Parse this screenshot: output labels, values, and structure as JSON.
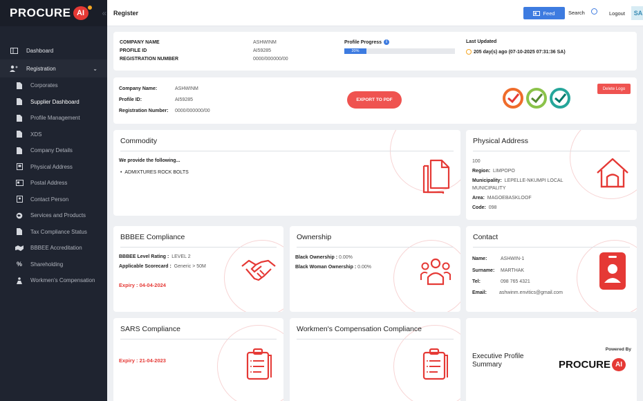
{
  "brand": {
    "name": "PROCURE",
    "ai": "AI"
  },
  "sidebar": {
    "items": [
      {
        "label": "Dashboard",
        "icon": "dashboard-icon"
      },
      {
        "label": "Registration",
        "icon": "user-plus-icon"
      }
    ],
    "sub_items": [
      {
        "label": "Corporates"
      },
      {
        "label": "Supplier Dashboard"
      },
      {
        "label": "Profile Management"
      },
      {
        "label": "XDS"
      },
      {
        "label": "Company Details"
      },
      {
        "label": "Physical Address"
      },
      {
        "label": "Postal Address"
      },
      {
        "label": "Contact Person"
      },
      {
        "label": "Services and Products"
      },
      {
        "label": "Tax Compliance Status"
      },
      {
        "label": "BBBEE Accreditation"
      },
      {
        "label": "Shareholding"
      },
      {
        "label": "Workmen's Compensation"
      }
    ]
  },
  "header": {
    "title": "Register",
    "feed": "Feed",
    "search": "Search",
    "logout": "Logout",
    "avatar": "SA"
  },
  "summary": {
    "company_name_label": "COMPANY NAME",
    "company_name": "ASHWINM",
    "profile_id_label": "PROFILE ID",
    "profile_id": "AI59285",
    "reg_label": "REGISTRATION NUMBER",
    "reg": "0000/000000/00",
    "progress_label": "Profile Progress",
    "progress_text": "20%",
    "progress_value": 0.2,
    "updated_label": "Last Updated",
    "updated": "205 day(s) ago (07-10-2025 07:31:36 SA)"
  },
  "company": {
    "name_label": "Company Name:",
    "name": "ASHWINM",
    "id_label": "Profile ID:",
    "id": "AI59285",
    "reg_label": "Registration Number:",
    "reg": "0000/000000/00",
    "export": "EXPORT TO PDF",
    "delete_logo": "Delete Logo"
  },
  "commodity": {
    "title": "Commodity",
    "intro": "We provide the following...",
    "items": [
      "ADMIXTURES ROCK BOLTS"
    ]
  },
  "physical": {
    "title": "Physical Address",
    "line1": "100",
    "region_label": "Region:",
    "region": "LIMPOPO",
    "municipality_label": "Municipality:",
    "municipality": "LEPELLE-NKUMPI LOCAL",
    "municipality_2": "MUNICIPALITY",
    "area_label": "Area:",
    "area": "MAGOEBASKLOOF",
    "code_label": "Code:",
    "code": "098"
  },
  "bbbee": {
    "title": "BBBEE Compliance",
    "level_label": "BBBEE Level Rating :",
    "level": "LEVEL 2",
    "scorecard_label": "Applicable Scorecard :",
    "scorecard": "Generic > 50M",
    "expiry": "Expiry : 04-04-2024"
  },
  "ownership": {
    "title": "Ownership",
    "black_label": "Black Ownership :",
    "black": "0.00%",
    "woman_label": "Black Woman Ownership :",
    "woman": "0.00%"
  },
  "contact": {
    "title": "Contact",
    "name_label": "Name:",
    "name": "ASHWIN-1",
    "surname_label": "Surname:",
    "surname": "MARTHAK",
    "tel_label": "Tel:",
    "tel": "098 765 4321",
    "email_label": "Email:",
    "email": "ashwinm.envitics@gmail.com"
  },
  "sars": {
    "title": "SARS Compliance",
    "expiry": "Expiry : 21-04-2023"
  },
  "workmen": {
    "title": "Workmen's Compensation Compliance"
  },
  "exec": {
    "title_1": "Executive Profile",
    "title_2": "Summary",
    "powered": "Powered By",
    "brand": "PROCURE",
    "ai": "AI"
  },
  "colors": {
    "accent_red": "#e53935",
    "primary_blue": "#3d7be0",
    "sidebar_bg": "#1f2430"
  }
}
